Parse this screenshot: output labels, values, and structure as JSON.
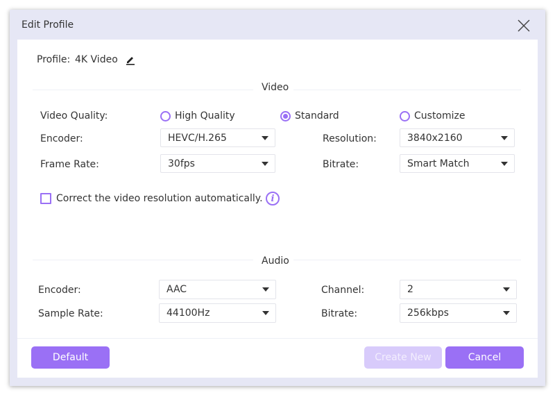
{
  "dialog": {
    "title": "Edit Profile",
    "close_icon": "close-icon"
  },
  "profile": {
    "label": "Profile:",
    "name": "4K Video",
    "edit_icon": "pencil-icon"
  },
  "video": {
    "section_title": "Video",
    "quality_label": "Video Quality:",
    "quality_options": [
      {
        "label": "High Quality",
        "checked": false
      },
      {
        "label": "Standard",
        "checked": true
      },
      {
        "label": "Customize",
        "checked": false
      }
    ],
    "encoder_label": "Encoder:",
    "encoder_value": "HEVC/H.265",
    "resolution_label": "Resolution:",
    "resolution_value": "3840x2160",
    "frame_rate_label": "Frame Rate:",
    "frame_rate_value": "30fps",
    "bitrate_label": "Bitrate:",
    "bitrate_value": "Smart Match",
    "auto_correct_label": "Correct the video resolution automatically.",
    "auto_correct_checked": false,
    "info_icon_glyph": "i"
  },
  "audio": {
    "section_title": "Audio",
    "encoder_label": "Encoder:",
    "encoder_value": "AAC",
    "channel_label": "Channel:",
    "channel_value": "2",
    "sample_rate_label": "Sample Rate:",
    "sample_rate_value": "44100Hz",
    "bitrate_label": "Bitrate:",
    "bitrate_value": "256kbps"
  },
  "footer": {
    "default_label": "Default",
    "create_new_label": "Create New",
    "create_new_enabled": false,
    "cancel_label": "Cancel"
  },
  "colors": {
    "accent": "#9a70f5",
    "accent_disabled": "#d8cbfb",
    "frame": "#e6e7f5"
  }
}
